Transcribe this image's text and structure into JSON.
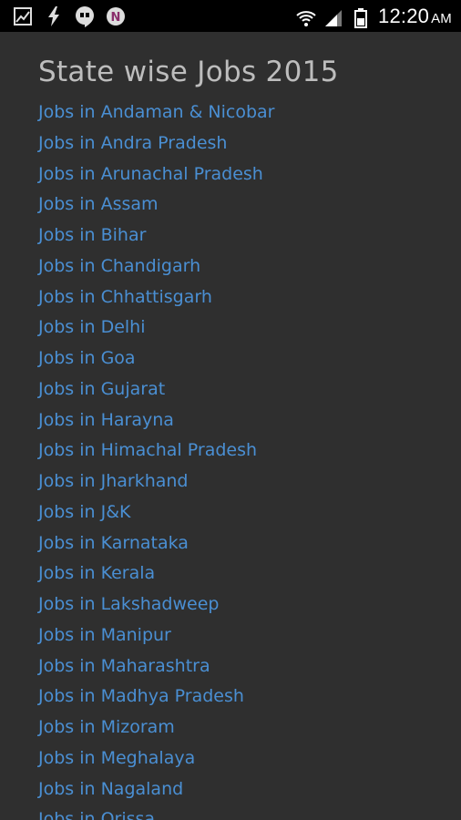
{
  "status_bar": {
    "time": "12:20",
    "ampm": "AM",
    "icons_left": [
      "gallery-icon",
      "flash-icon",
      "hangouts-icon",
      "notification-n-icon"
    ],
    "icons_right": [
      "wifi-icon",
      "signal-icon",
      "battery-icon"
    ]
  },
  "page": {
    "title": "State wise Jobs 2015",
    "items": [
      "Jobs in Andaman & Nicobar",
      "Jobs in Andra Pradesh",
      "Jobs in Arunachal Pradesh",
      "Jobs in Assam",
      "Jobs in Bihar",
      "Jobs in Chandigarh",
      "Jobs in Chhattisgarh",
      "Jobs in Delhi",
      "Jobs in Goa",
      "Jobs in Gujarat",
      "Jobs in Harayna",
      "Jobs in Himachal Pradesh",
      "Jobs in Jharkhand",
      "Jobs in J&K",
      "Jobs in Karnataka",
      "Jobs in Kerala",
      "Jobs in Lakshadweep",
      "Jobs in Manipur",
      "Jobs in Maharashtra",
      "Jobs in Madhya Pradesh",
      "Jobs in Mizoram",
      "Jobs in Meghalaya",
      "Jobs in Nagaland",
      "Jobs in Orissa"
    ]
  },
  "colors": {
    "background": "#2f2f2f",
    "status_bar": "#000000",
    "link": "#4a8fd3",
    "title": "#bdbdbd"
  }
}
